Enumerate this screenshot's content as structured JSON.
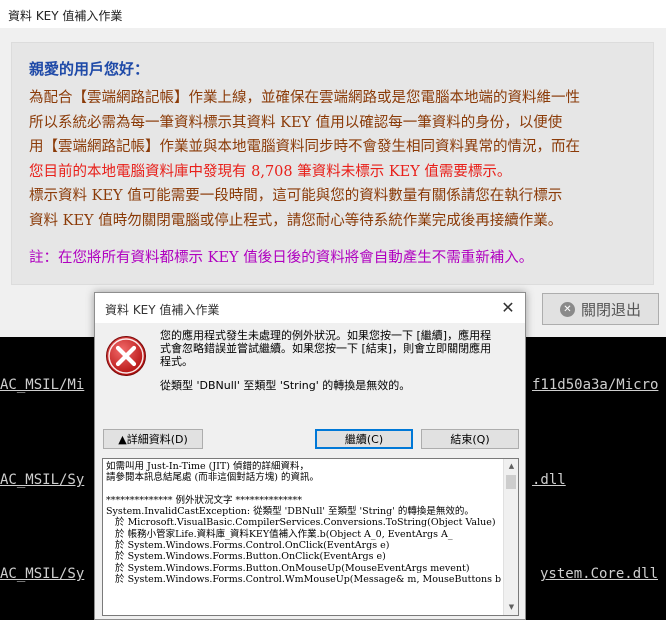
{
  "main_window": {
    "title": "資料 KEY 值補入作業",
    "notice": {
      "heading": "親愛的用戶您好：",
      "lines": [
        "為配合【雲端網路記帳】作業上線，並確保在雲端網路或是您電腦本地端的資料維一性",
        "所以系統必需為每一筆資料標示其資料 KEY 值用以確認每一筆資料的身份，以便使",
        "用【雲端網路記帳】作業並與本地電腦資料同步時不會發生相同資料異常的情況，而在"
      ],
      "red_line": "您目前的本地電腦資料庫中發現有 8,708 筆資料未標示 KEY 值需要標示。",
      "lines2": [
        "標示資料 KEY 值可能需要一段時間，這可能與您的資料數量有關係請您在執行標示",
        "資料 KEY 值時勿關閉電腦或停止程式，請您耐心等待系統作業完成後再接續作業。"
      ],
      "note": "註：在您將所有資料都標示 KEY 值後日後的資料將會自動產生不需重新補入。"
    },
    "close_button_label": "關閉退出"
  },
  "console": {
    "lines": [
      "AC_MSIL/Mi",
      "f11d50a3a/Micro",
      "AC_MSIL/Sy",
      ".dll",
      "AC_MSIL/Sy",
      "ystem.Core.dll"
    ]
  },
  "dialog": {
    "title": "資料 KEY 值補入作業",
    "close_glyph": "✕",
    "message": "您的應用程式發生未處理的例外狀況。如果您按一下 [繼續]，應用程式會忽略錯誤並嘗試繼續。如果您按一下 [結束]，則會立即關閉應用程式。",
    "error_text": "從類型 'DBNull' 至類型 'String' 的轉換是無效的。",
    "buttons": {
      "details": "▲詳細資料(D)",
      "continue": "繼續(C)",
      "quit": "結束(Q)"
    },
    "details_text": "如需叫用 Just-In-Time (JIT) 偵錯的詳細資料，\n請參閱本訊息結尾處 (而非這個對話方塊) 的資訊。\n\n************** 例外狀況文字 **************\nSystem.InvalidCastException: 從類型 'DBNull' 至類型 'String' 的轉換是無效的。\n   於 Microsoft.VisualBasic.CompilerServices.Conversions.ToString(Object Value)\n   於 帳務小管家Life.資料庫_資料KEY值補入作業.b(Object A_0, EventArgs A_\n   於 System.Windows.Forms.Control.OnClick(EventArgs e)\n   於 System.Windows.Forms.Button.OnClick(EventArgs e)\n   於 System.Windows.Forms.Button.OnMouseUp(MouseEventArgs mevent)\n   於 System.Windows.Forms.Control.WmMouseUp(Message& m, MouseButtons bu"
  }
}
